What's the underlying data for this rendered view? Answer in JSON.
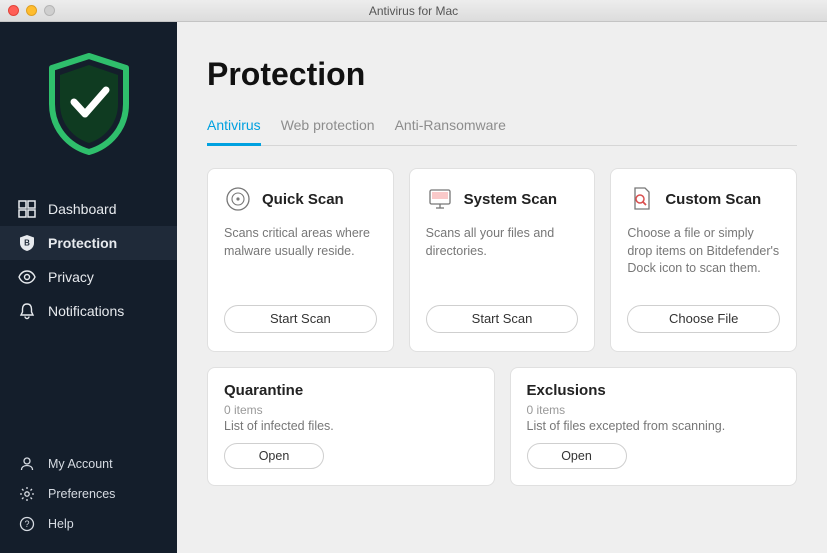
{
  "window": {
    "title": "Antivirus for Mac"
  },
  "sidebar": {
    "items": [
      {
        "label": "Dashboard"
      },
      {
        "label": "Protection"
      },
      {
        "label": "Privacy"
      },
      {
        "label": "Notifications"
      }
    ],
    "bottom_items": [
      {
        "label": "My Account"
      },
      {
        "label": "Preferences"
      },
      {
        "label": "Help"
      }
    ]
  },
  "main": {
    "title": "Protection",
    "tabs": [
      {
        "label": "Antivirus"
      },
      {
        "label": "Web protection"
      },
      {
        "label": "Anti-Ransomware"
      }
    ],
    "scan_cards": [
      {
        "title": "Quick Scan",
        "desc": "Scans critical areas where malware usually reside.",
        "button": "Start Scan"
      },
      {
        "title": "System Scan",
        "desc": "Scans all your files and directories.",
        "button": "Start Scan"
      },
      {
        "title": "Custom Scan",
        "desc": "Choose a file or simply drop items on Bitdefender's Dock icon to scan them.",
        "button": "Choose File"
      }
    ],
    "info_cards": [
      {
        "title": "Quarantine",
        "items_label": "0 items",
        "desc": "List of infected files.",
        "button": "Open"
      },
      {
        "title": "Exclusions",
        "items_label": "0 items",
        "desc": "List of files excepted from scanning.",
        "button": "Open"
      }
    ]
  }
}
